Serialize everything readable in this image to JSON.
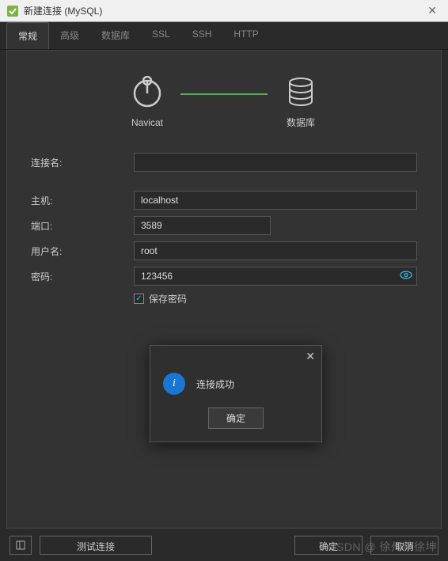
{
  "window": {
    "title": "新建连接 (MySQL)"
  },
  "tabs": [
    "常规",
    "高级",
    "数据库",
    "SSL",
    "SSH",
    "HTTP"
  ],
  "active_tab_index": 0,
  "diagram": {
    "left_label": "Navicat",
    "right_label": "数据库"
  },
  "fields": {
    "connection_name": {
      "label": "连接名:",
      "value": ""
    },
    "host": {
      "label": "主机:",
      "value": "localhost"
    },
    "port": {
      "label": "端口:",
      "value": "3589"
    },
    "username": {
      "label": "用户名:",
      "value": "root"
    },
    "password": {
      "label": "密码:",
      "value": "123456"
    },
    "save_password": {
      "label": "保存密码",
      "checked": true
    }
  },
  "dialog": {
    "message": "连接成功",
    "ok_label": "确定"
  },
  "footer": {
    "test_label": "测试连接",
    "ok_label": "确定",
    "cancel_label": "取消"
  },
  "watermark": "CSDN @ 徐州蔡徐坤"
}
